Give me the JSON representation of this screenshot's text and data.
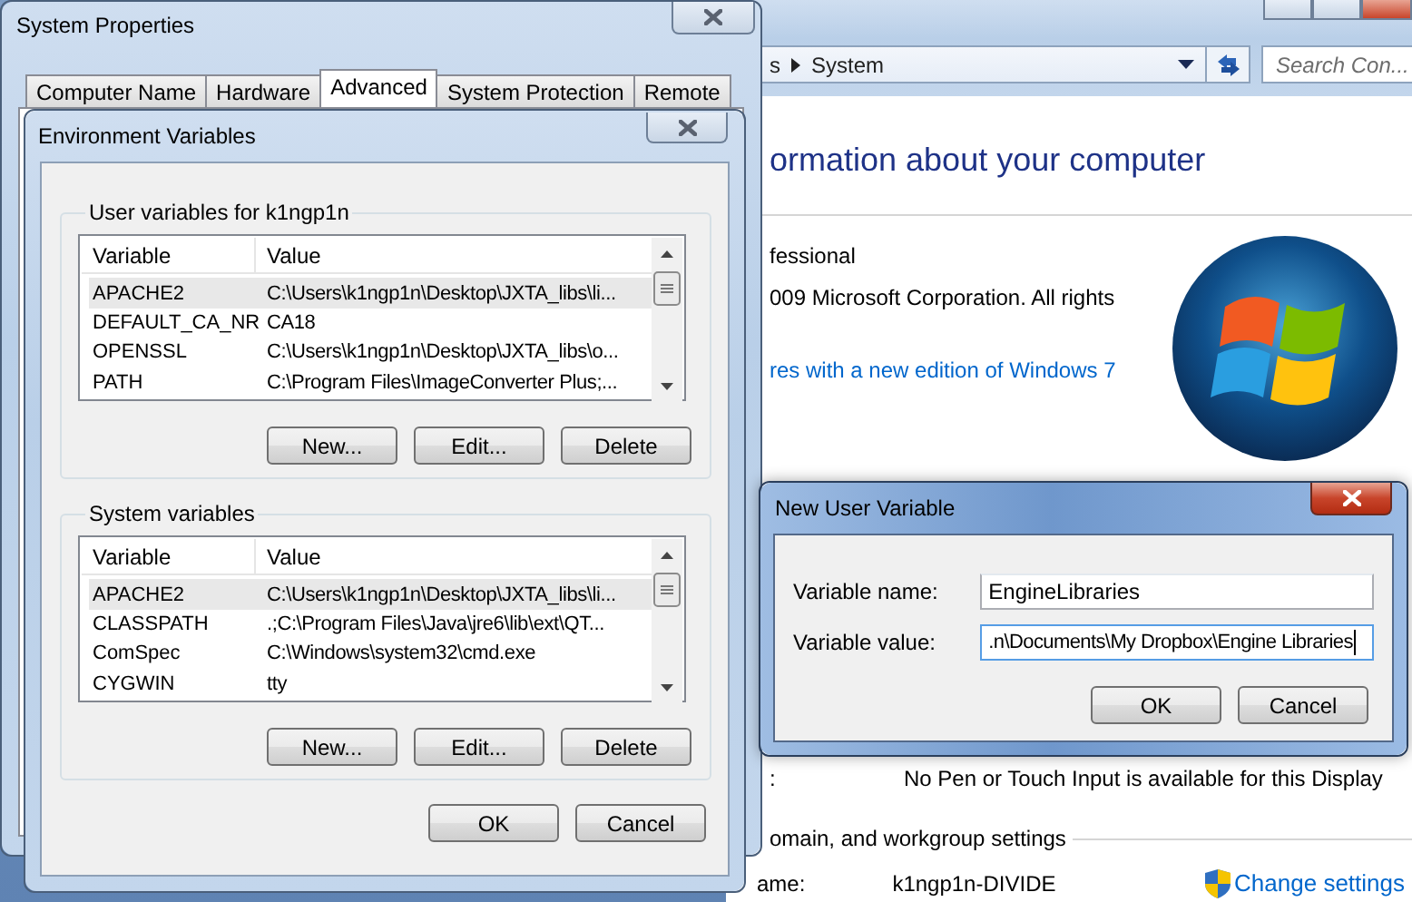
{
  "control_panel": {
    "breadcrumb": [
      "s",
      "System"
    ],
    "search": {
      "placeholder": "Search Con..."
    },
    "heading": "ormation about your computer",
    "edition": "fessional",
    "copyright": "009 Microsoft Corporation.  All rights",
    "upgrade_link": "res with a new edition of Windows 7",
    "pen_label": ":",
    "pen_value": "No Pen or Touch Input is available for this Display",
    "network_section": "omain, and workgroup settings",
    "computer_name_label": "ame:",
    "computer_name": "k1ngp1n-DIVIDE",
    "change_settings": "Change settings"
  },
  "system_properties": {
    "title": "System Properties",
    "tabs": [
      {
        "label": "Computer Name",
        "selected": false
      },
      {
        "label": "Hardware",
        "selected": false
      },
      {
        "label": "Advanced",
        "selected": true
      },
      {
        "label": "System Protection",
        "selected": false
      },
      {
        "label": "Remote",
        "selected": false
      }
    ]
  },
  "environment_variables": {
    "title": "Environment Variables",
    "groups": [
      {
        "title": "User variables for k1ngp1n",
        "columns": [
          "Variable",
          "Value"
        ],
        "rows": [
          {
            "variable": "APACHE2",
            "value": "C:\\Users\\k1ngp1n\\Desktop\\JXTA_libs\\li...",
            "selected": true
          },
          {
            "variable": "DEFAULT_CA_NR",
            "value": "CA18",
            "selected": false
          },
          {
            "variable": "OPENSSL",
            "value": "C:\\Users\\k1ngp1n\\Desktop\\JXTA_libs\\o...",
            "selected": false
          },
          {
            "variable": "PATH",
            "value": "C:\\Program Files\\ImageConverter Plus;...",
            "selected": false
          }
        ],
        "buttons": [
          "New...",
          "Edit...",
          "Delete"
        ]
      },
      {
        "title": "System variables",
        "columns": [
          "Variable",
          "Value"
        ],
        "rows": [
          {
            "variable": "APACHE2",
            "value": "C:\\Users\\k1ngp1n\\Desktop\\JXTA_libs\\li...",
            "selected": true
          },
          {
            "variable": "CLASSPATH",
            "value": ".;C:\\Program Files\\Java\\jre6\\lib\\ext\\QT...",
            "selected": false
          },
          {
            "variable": "ComSpec",
            "value": "C:\\Windows\\system32\\cmd.exe",
            "selected": false
          },
          {
            "variable": "CYGWIN",
            "value": "tty",
            "selected": false
          }
        ],
        "buttons": [
          "New...",
          "Edit...",
          "Delete"
        ]
      }
    ],
    "buttons": [
      "OK",
      "Cancel"
    ]
  },
  "new_user_variable": {
    "title": "New User Variable",
    "fields": [
      {
        "label": "Variable name:",
        "value": "EngineLibraries",
        "focused": false
      },
      {
        "label": "Variable value:",
        "value": ".n\\Documents\\My Dropbox\\Engine Libraries",
        "focused": true
      }
    ],
    "buttons": [
      "OK",
      "Cancel"
    ]
  }
}
